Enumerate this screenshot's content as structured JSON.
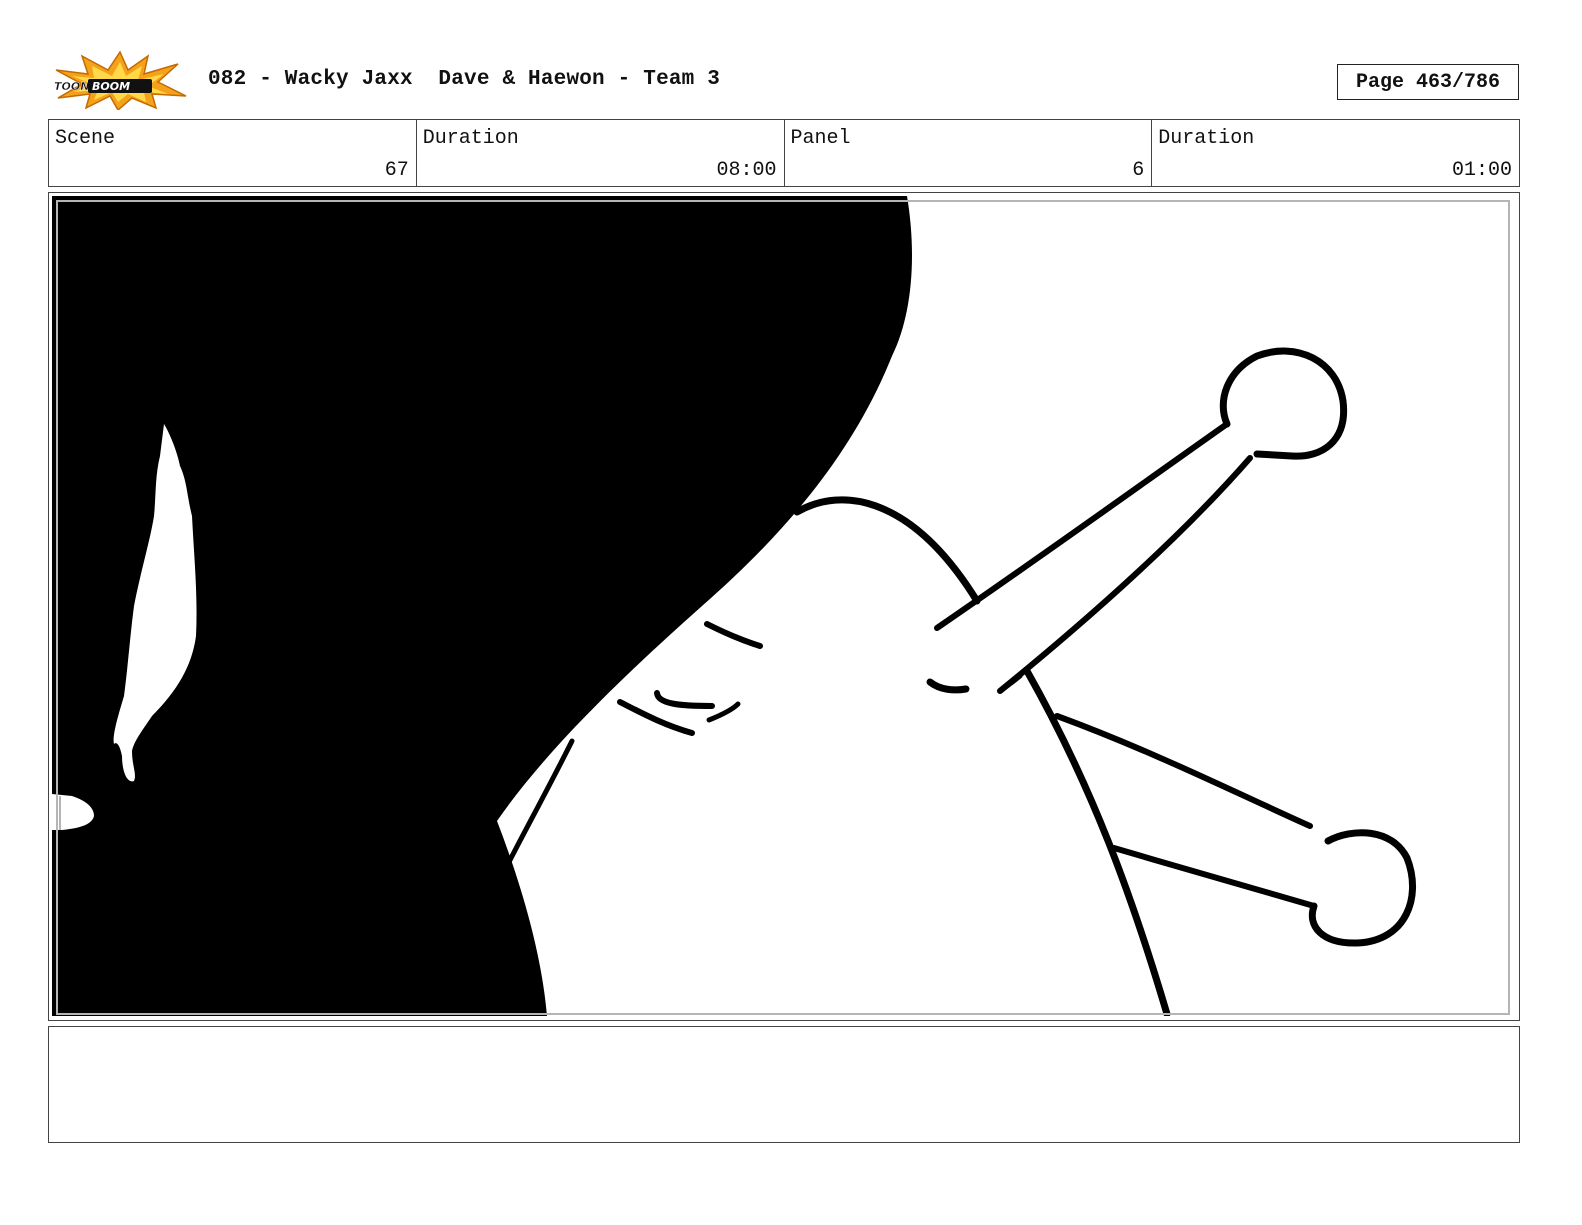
{
  "header": {
    "logo_text": "TOONBOOM",
    "title": "082 - Wacky Jaxx  Dave & Haewon - Team 3",
    "page_label": "Page 463/786"
  },
  "info": {
    "scene_label": "Scene",
    "scene_value": "67",
    "scene_duration_label": "Duration",
    "scene_duration_value": "08:00",
    "panel_label": "Panel",
    "panel_value": "6",
    "panel_duration_label": "Duration",
    "panel_duration_value": "01:00"
  },
  "notes": {
    "text": ""
  },
  "colors": {
    "ink": "#000000",
    "frame": "#444444",
    "safe_frame": "#b5b5b5",
    "logo_orange": "#f5a21b",
    "logo_yellow": "#ffd94a"
  }
}
